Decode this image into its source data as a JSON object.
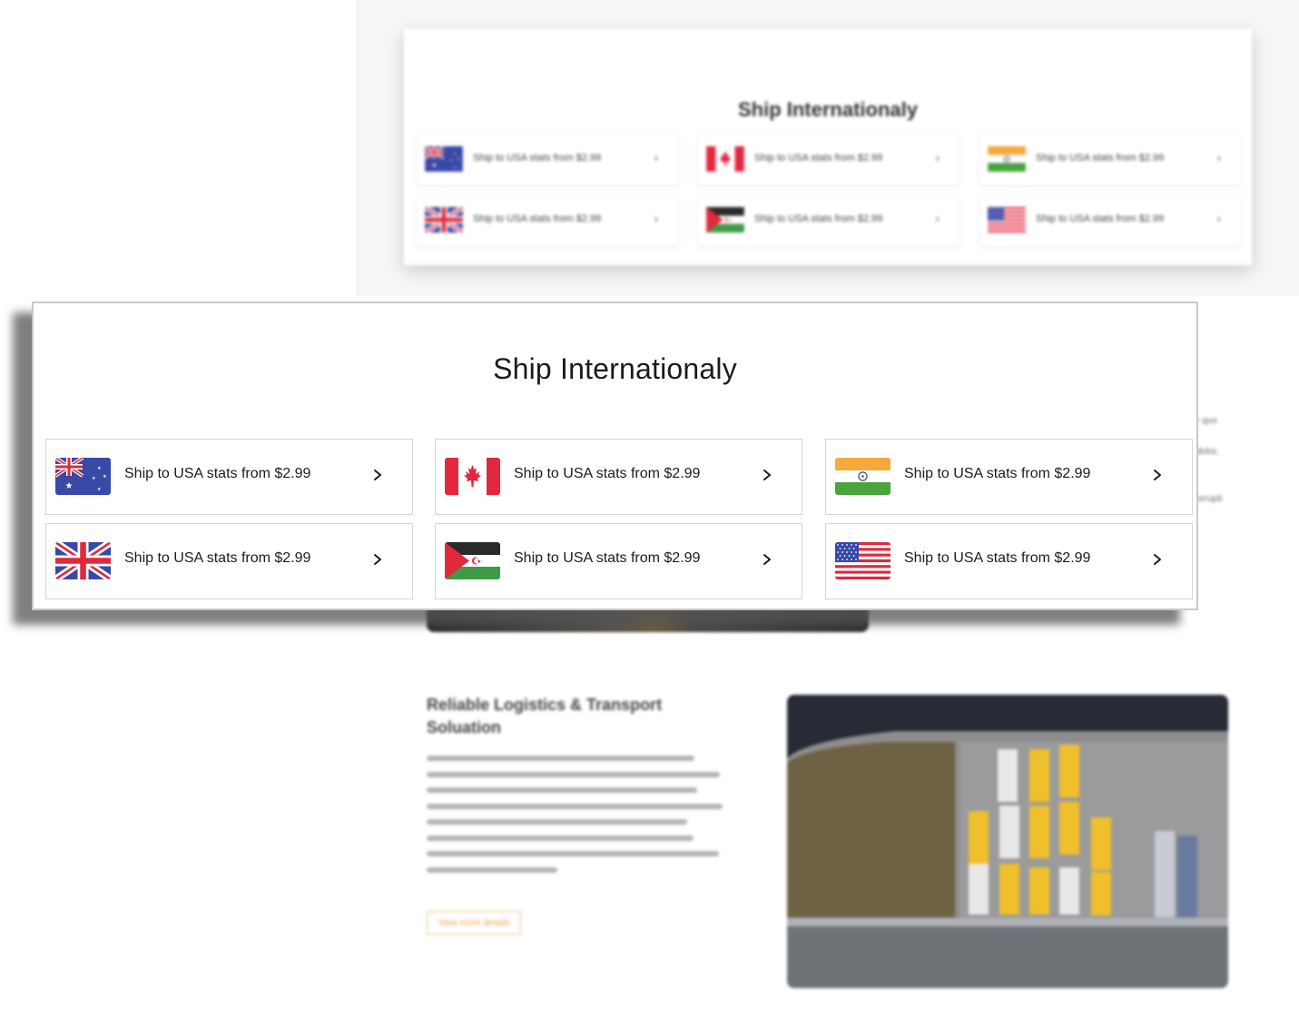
{
  "background": {
    "card_title": "Ship Internationaly",
    "tile_text": "Ship to USA stats from $2.99",
    "side_text": [
      "r quo",
      "dolor,",
      "orrupti"
    ],
    "article_title": "Reliable Logistics & Transport Soluation",
    "article_body": "Lorem ipsum dolor, sit amet consectetur adipisicing elit. Eos dolorem delectus, accusamus mollitia illum doloribus incidunt quo repellendus tempora quam est fugiat quas ducimus! Adipisci delectus corrupti praesentium debitis! Veritatis Lorem ipsum dolor, sit amet consectetur adipisicing elit. Eos dolorem delectus, accusamus mollitia illum doloribus incidunt quo repellendus tempora quam est fugiat quas ducimus! Adipisci delectus corrupti praesentium debitis! Veritatis",
    "article_button": "View more details"
  },
  "shipping": {
    "title": "Ship Internationaly",
    "tiles": [
      {
        "country": "Australia",
        "flag_icon": "australia-flag-icon",
        "text": "Ship to USA stats from $2.99",
        "chevron": "chevron-right-icon"
      },
      {
        "country": "Canada",
        "flag_icon": "canada-flag-icon",
        "text": "Ship to USA stats from $2.99",
        "chevron": "chevron-right-icon"
      },
      {
        "country": "India",
        "flag_icon": "india-flag-icon",
        "text": "Ship to USA stats from $2.99",
        "chevron": "chevron-right-icon"
      },
      {
        "country": "United Kingdom",
        "flag_icon": "uk-flag-icon",
        "text": "Ship to USA stats from $2.99",
        "chevron": "chevron-right-icon"
      },
      {
        "country": "Western Sahara",
        "flag_icon": "western-sahara-flag-icon",
        "text": "Ship to USA stats from $2.99",
        "chevron": "chevron-right-icon"
      },
      {
        "country": "United States",
        "flag_icon": "usa-flag-icon",
        "text": "Ship to USA stats from $2.99",
        "chevron": "chevron-right-icon"
      }
    ]
  },
  "colors": {
    "accent_orange": "#f1a54a",
    "flag_blue": "#3b4aa3",
    "flag_red": "#e2283d",
    "flag_green": "#4aa33b",
    "flag_saffron": "#f5a93a"
  }
}
